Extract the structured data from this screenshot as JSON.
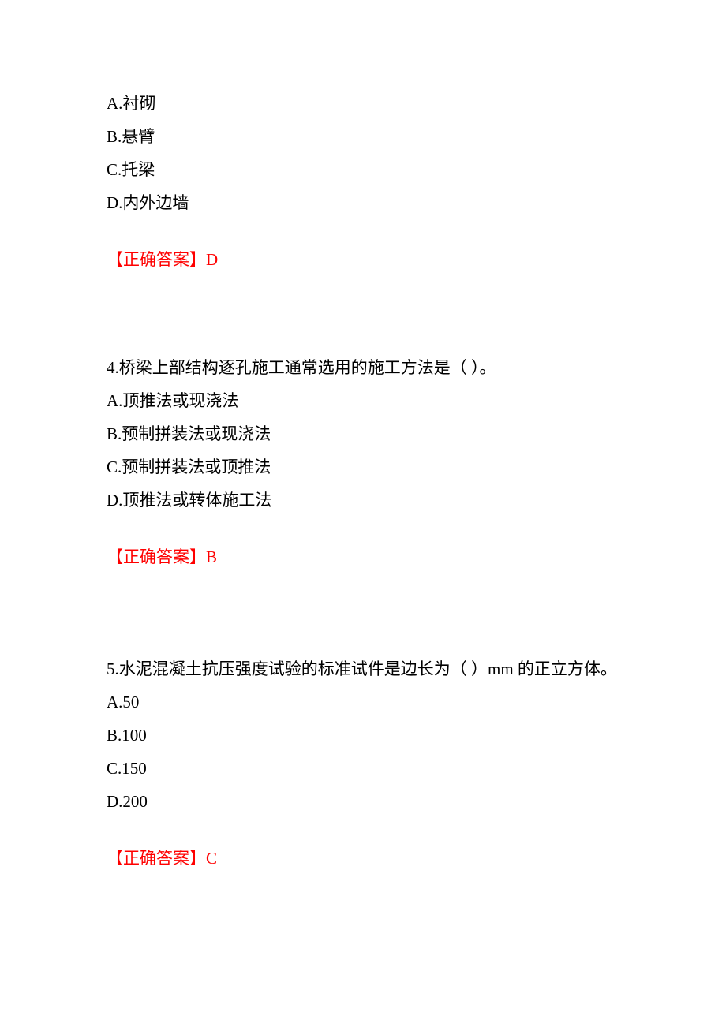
{
  "q3": {
    "options": {
      "a": "A.衬砌",
      "b": "B.悬臂",
      "c": "C.托梁",
      "d": "D.内外边墙"
    },
    "answer": "【正确答案】D"
  },
  "q4": {
    "stem": "4.桥梁上部结构逐孔施工通常选用的施工方法是（  ）。",
    "options": {
      "a": "A.顶推法或现浇法",
      "b": "B.预制拼装法或现浇法",
      "c": "C.预制拼装法或顶推法",
      "d": "D.顶推法或转体施工法"
    },
    "answer": "【正确答案】B"
  },
  "q5": {
    "stem": "5.水泥混凝土抗压强度试验的标准试件是边长为（  ）mm 的正立方体。",
    "options": {
      "a": "A.50",
      "b": "B.100",
      "c": "C.150",
      "d": "D.200"
    },
    "answer": "【正确答案】C"
  }
}
